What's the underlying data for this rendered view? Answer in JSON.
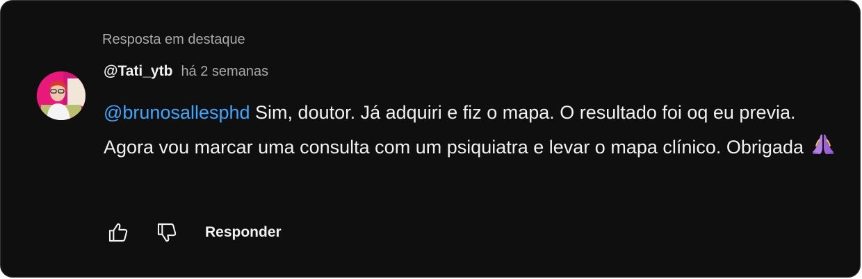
{
  "thread": {
    "header_label": "Resposta em destaque"
  },
  "comment": {
    "author": "@Tati_ytb",
    "timestamp": "há 2 semanas",
    "mention": "@brunosallesphd",
    "text": " Sim, doutor. Já adquiri e fiz o mapa. O resultado foi oq eu previa. Agora vou marcar uma consulta com um psiquiatra e levar o mapa clínico. Obrigada",
    "emoji": "folded-hands"
  },
  "actions": {
    "like_icon": "thumbs-up-icon",
    "dislike_icon": "thumbs-down-icon",
    "reply_label": "Responder"
  },
  "colors": {
    "background": "#0f0f0f",
    "text_primary": "#f1f1f1",
    "text_secondary": "#aaaaaa",
    "mention": "#3ea6ff",
    "border": "#3a3a3a"
  }
}
